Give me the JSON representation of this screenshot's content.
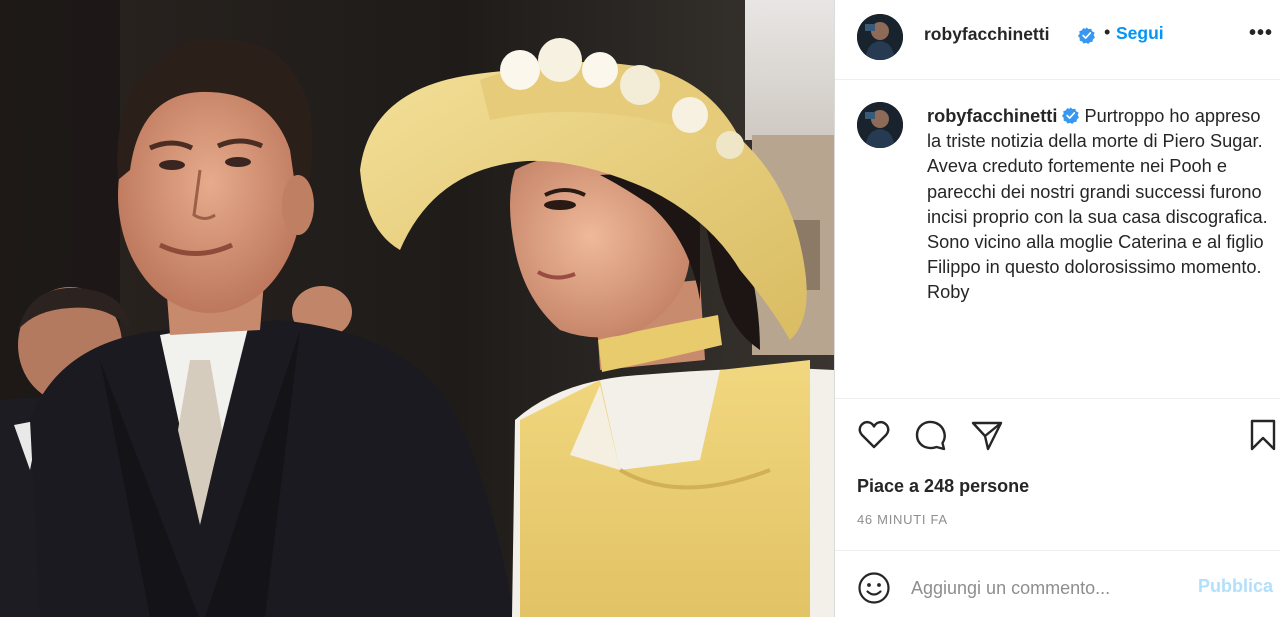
{
  "post": {
    "photo_alt": "",
    "account": {
      "username": "robyfacchinetti",
      "verified": true,
      "follow_label": "Segui",
      "separator": "•",
      "more_label": "•••"
    },
    "caption": {
      "username": "robyfacchinetti",
      "text": "Purtroppo ho appreso la triste notizia della morte di Piero Sugar.\nAveva creduto fortemente nei Pooh e parecchi dei nostri grandi successi furono incisi proprio con la sua casa discografica.\nSono vicino alla moglie Caterina e al figlio Filippo in questo dolorosissimo momento.\nRoby"
    },
    "actions": {
      "like_icon": "heart-icon",
      "comment_icon": "comment-icon",
      "share_icon": "paper-plane-icon",
      "save_icon": "bookmark-icon"
    },
    "likes_label": "Piace a 248 persone",
    "timestamp": "46 MINUTI FA",
    "comment": {
      "placeholder": "Aggiungi un commento...",
      "publish_label": "Pubblica",
      "emoji_icon": "smiley-icon"
    }
  },
  "colors": {
    "accent": "#0095f6",
    "publish_disabled": "#b2dffc",
    "verified": "#3897f0",
    "muted_text": "#8e8e8e",
    "border": "#dbdbdb"
  }
}
